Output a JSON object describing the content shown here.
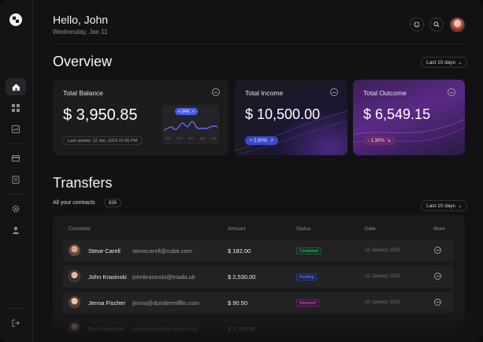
{
  "header": {
    "greeting": "Hello, John",
    "date": "Wednesday, Jan 11"
  },
  "overview": {
    "title": "Overview",
    "filter_label": "Last 10 days",
    "cards": [
      {
        "title": "Total Balance",
        "value": "$ 3,950.85",
        "last_update": "Last update: 11 Jan, 2023 07:00 PM",
        "mini_chart": {
          "badge": "+ 24%",
          "months": [
            "SEP",
            "OCT",
            "DEC",
            "JAN",
            "FEB"
          ]
        }
      },
      {
        "title": "Total Income",
        "value": "$ 10,500.00",
        "change": "+ 2.80%"
      },
      {
        "title": "Total Outcome",
        "value": "$ 6,549.15",
        "change": "- 1.30%"
      }
    ]
  },
  "transfers": {
    "title": "Transfers",
    "contracts_label": "All your contracts",
    "contracts_count": "826",
    "filter_label": "Last 10 days",
    "columns": [
      "Customer",
      "Amount",
      "Status",
      "Date",
      "More"
    ],
    "rows": [
      {
        "name": "Steve Carell",
        "email": "stevecarell@cube.com",
        "amount": "$ 182.00",
        "status": "Completed",
        "date": "10 January 2023"
      },
      {
        "name": "John Krasinski",
        "email": "johnkrasinski@triada.uk",
        "amount": "$ 2,530.00",
        "status": "Pending",
        "date": "10 January 2023"
      },
      {
        "name": "Jenna Fischer",
        "email": "jenna@dundermifflin.com",
        "amount": "$ 90.50",
        "status": "Returned",
        "date": "10 January 2023"
      },
      {
        "name": "Paul Giamatti",
        "email": "paulgiamatti@column.sp",
        "amount": "$ 1,500.95",
        "status": "",
        "date": ""
      }
    ]
  },
  "colors": {
    "background": "#121214",
    "income_accent": "#5b5cf6",
    "outcome_accent": "#b94bd8",
    "completed": "#3ecf6e",
    "pending": "#5a7cf5",
    "returned": "#d24bd0"
  },
  "icons": {
    "sidebar": [
      "home-icon",
      "grid-icon",
      "chart-icon",
      "wallet-icon",
      "document-icon",
      "settings-icon",
      "user-icon",
      "logout-icon"
    ],
    "header": [
      "notification-icon",
      "search-icon"
    ]
  }
}
